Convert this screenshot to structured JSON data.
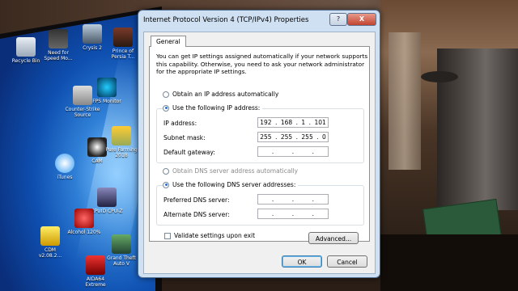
{
  "desktop": {
    "icons": [
      {
        "label": "Recycle Bin"
      },
      {
        "label": "Need for Speed Mo..."
      },
      {
        "label": "Crysis 2"
      },
      {
        "label": "Prince of Persia T..."
      },
      {
        "label": "Counter-Strike Source"
      },
      {
        "label": "FPS Monitor"
      },
      {
        "label": "CAM"
      },
      {
        "label": "Pure Farming 2018"
      },
      {
        "label": "iTunes"
      },
      {
        "label": "CPUID CPU-Z"
      },
      {
        "label": "Alcohol 120%"
      },
      {
        "label": "Grand Theft Auto V"
      },
      {
        "label": "CDM v2.08.2..."
      },
      {
        "label": "AIDA64 Extreme"
      }
    ]
  },
  "dialog": {
    "title": "Internet Protocol Version 4 (TCP/IPv4) Properties",
    "help_label": "?",
    "close_label": "X",
    "tab_general": "General",
    "intro_text": "You can get IP settings assigned automatically if your network supports this capability. Otherwise, you need to ask your network administrator for the appropriate IP settings.",
    "ip_auto_label": "Obtain an IP address automatically",
    "ip_manual_label": "Use the following IP address:",
    "ip_address_label": "IP address:",
    "ip_address": [
      "192",
      "168",
      "1",
      "101"
    ],
    "subnet_label": "Subnet mask:",
    "subnet": [
      "255",
      "255",
      "255",
      "0"
    ],
    "gateway_label": "Default gateway:",
    "gateway": [
      "",
      "",
      "",
      ""
    ],
    "dns_auto_label": "Obtain DNS server address automatically",
    "dns_manual_label": "Use the following DNS server addresses:",
    "preferred_dns_label": "Preferred DNS server:",
    "preferred_dns": [
      "",
      "",
      "",
      ""
    ],
    "alternate_dns_label": "Alternate DNS server:",
    "alternate_dns": [
      "",
      "",
      "",
      ""
    ],
    "validate_label": "Validate settings upon exit",
    "advanced_label": "Advanced...",
    "ok_label": "OK",
    "cancel_label": "Cancel"
  }
}
